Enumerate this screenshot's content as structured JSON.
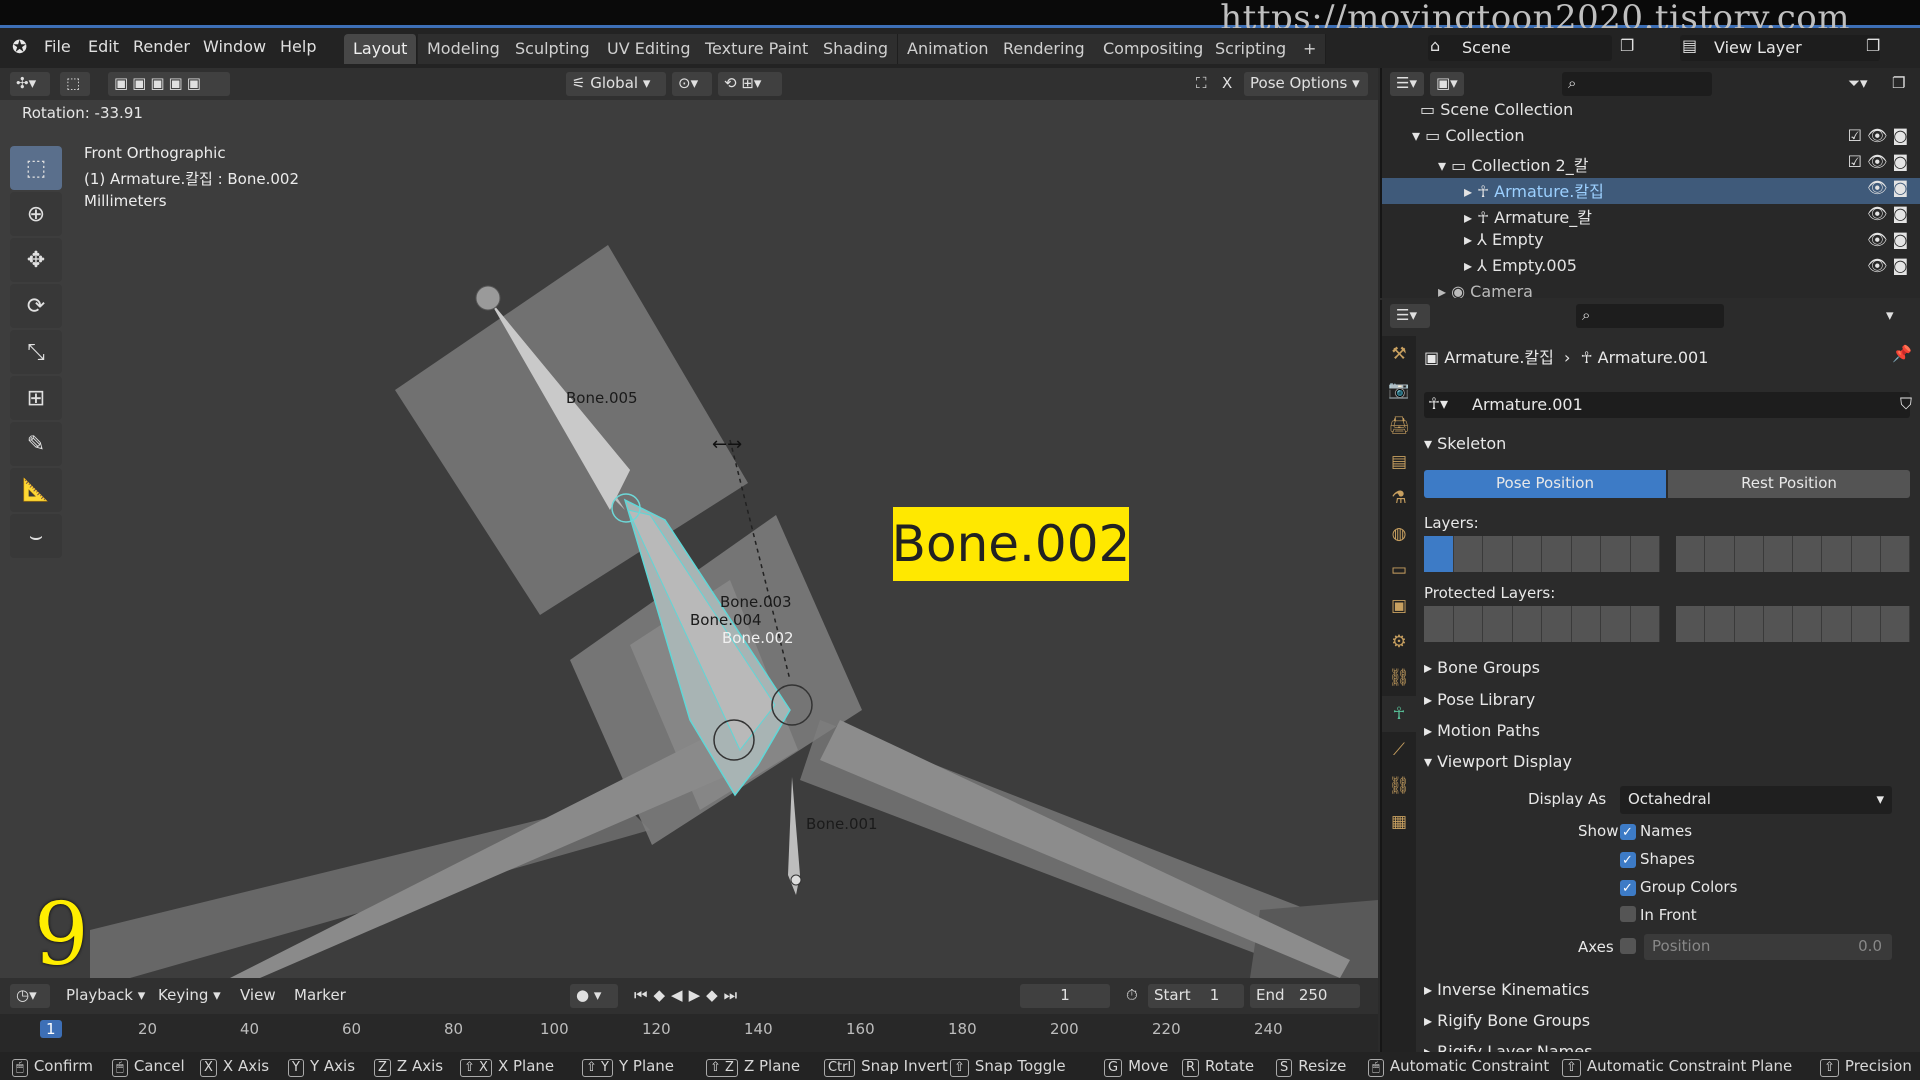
{
  "watermark": "https://movingtoon2020.tistory.com",
  "menu": {
    "items": [
      "File",
      "Edit",
      "Render",
      "Window",
      "Help"
    ],
    "workspaces": [
      "Layout",
      "Modeling",
      "Sculpting",
      "UV Editing",
      "Texture Paint",
      "Shading",
      "Animation",
      "Rendering",
      "Compositing",
      "Scripting"
    ],
    "active_workspace": "Layout",
    "add_tab": "+",
    "scene": "Scene",
    "view_layer": "View Layer"
  },
  "viewport_header": {
    "orientation": "Global",
    "pose_options": "Pose Options",
    "x_label": "X"
  },
  "viewport": {
    "rotation": "Rotation: -33.91",
    "view_name": "Front Orthographic",
    "object_info": "(1) Armature.칼집 : Bone.002",
    "units": "Millimeters",
    "bones": [
      "Bone.005",
      "Bone.003",
      "Bone.004",
      "Bone.002",
      "Bone.001"
    ],
    "callout": "Bone.002",
    "step_number": "9"
  },
  "timeline": {
    "menus": [
      "Playback",
      "Keying",
      "View",
      "Marker"
    ],
    "current_frame": "1",
    "start_label": "Start",
    "start": "1",
    "end_label": "End",
    "end": "250",
    "ticks": [
      "1",
      "20",
      "40",
      "60",
      "80",
      "100",
      "120",
      "140",
      "160",
      "180",
      "200",
      "220",
      "240"
    ]
  },
  "statusbar": {
    "items": [
      {
        "key": "",
        "label": "Confirm"
      },
      {
        "key": "",
        "label": "Cancel"
      },
      {
        "key": "X",
        "label": "X Axis"
      },
      {
        "key": "Y",
        "label": "Y Axis"
      },
      {
        "key": "Z",
        "label": "Z Axis"
      },
      {
        "key": "⇧ X",
        "label": "X Plane"
      },
      {
        "key": "⇧ Y",
        "label": "Y Plane"
      },
      {
        "key": "⇧ Z",
        "label": "Z Plane"
      },
      {
        "key": "Ctrl",
        "label": "Snap Invert"
      },
      {
        "key": "⇧",
        "label": "Snap Toggle"
      },
      {
        "key": "G",
        "label": "Move"
      },
      {
        "key": "R",
        "label": "Rotate"
      },
      {
        "key": "S",
        "label": "Resize"
      },
      {
        "key": "",
        "label": "Automatic Constraint"
      },
      {
        "key": "⇧",
        "label": "Automatic Constraint Plane"
      },
      {
        "key": "⇧",
        "label": "Precision"
      }
    ]
  },
  "outliner": {
    "rows": [
      "Scene Collection",
      "Collection",
      "Collection 2_칼",
      "Armature.칼집",
      "Armature_칼",
      "Empty",
      "Empty.005",
      "Camera"
    ]
  },
  "properties": {
    "breadcrumb_object": "Armature.칼집",
    "breadcrumb_data": "Armature.001",
    "data_name": "Armature.001",
    "skeleton": "Skeleton",
    "pose_position": "Pose Position",
    "rest_position": "Rest Position",
    "layers": "Layers:",
    "protected_layers": "Protected Layers:",
    "sections": [
      "Bone Groups",
      "Pose Library",
      "Motion Paths"
    ],
    "viewport_display": "Viewport Display",
    "display_as_label": "Display As",
    "display_as_value": "Octahedral",
    "show_label": "Show",
    "show_names": "Names",
    "show_shapes": "Shapes",
    "show_group_colors": "Group Colors",
    "in_front": "In Front",
    "axes_label": "Axes",
    "axes_position": "Position",
    "axes_value": "0.0",
    "more_sections": [
      "Inverse Kinematics",
      "Rigify Bone Groups",
      "Rigify Layer Names"
    ]
  }
}
